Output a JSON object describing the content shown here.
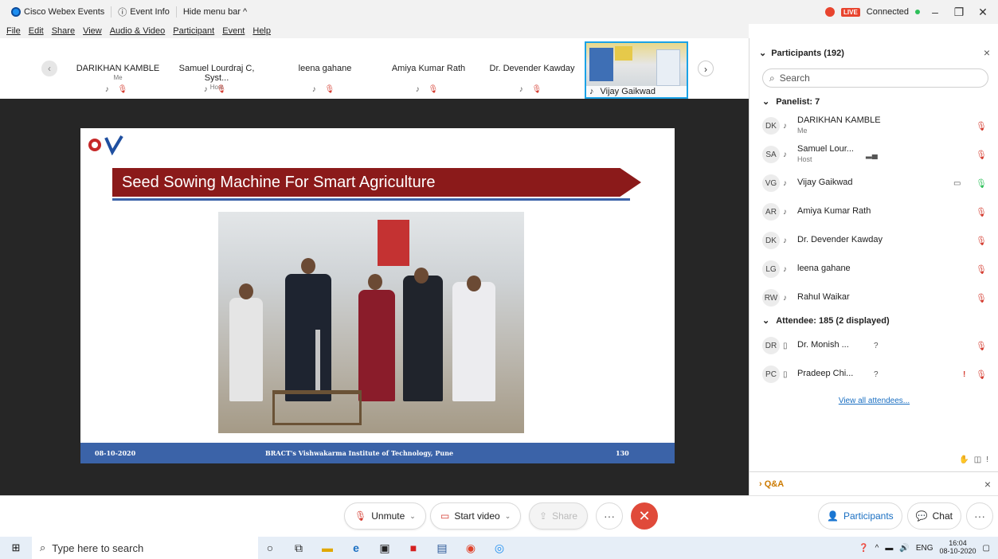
{
  "titlebar": {
    "app_name": "Cisco Webex Events",
    "event_info": "Event Info",
    "hide_menu": "Hide menu bar ^",
    "status": "Connected",
    "live_badge": "LIVE"
  },
  "menu": [
    "File",
    "Edit",
    "Share",
    "View",
    "Audio & Video",
    "Participant",
    "Event",
    "Help"
  ],
  "strip": {
    "tiles": [
      {
        "name": "DARIKHAN KAMBLE",
        "role": "Me"
      },
      {
        "name": "Samuel Lourdraj C, Syst...",
        "role": "Host"
      },
      {
        "name": "leena gahane",
        "role": ""
      },
      {
        "name": "Amiya Kumar Rath",
        "role": ""
      },
      {
        "name": "Dr. Devender Kawday",
        "role": ""
      }
    ],
    "video_tile_name": "Vijay Gaikwad"
  },
  "slide": {
    "title": "Seed Sowing Machine For Smart Agriculture",
    "footer_date": "08-10-2020",
    "footer_institute": "BRACT's Vishwakarma Institute of Technology, Pune",
    "footer_page": "130"
  },
  "controls": {
    "unmute": "Unmute",
    "start_video": "Start video",
    "share": "Share",
    "more": "···",
    "end": "✕"
  },
  "panel": {
    "title": "Participants (192)",
    "search_placeholder": "Search",
    "panelist_header": "Panelist: 7",
    "panelists": [
      {
        "initials": "DK",
        "name": "DARIKHAN KAMBLE",
        "role": "Me"
      },
      {
        "initials": "SA",
        "name": "Samuel Lour...",
        "role": "Host"
      },
      {
        "initials": "VG",
        "name": "Vijay Gaikwad",
        "role": ""
      },
      {
        "initials": "AR",
        "name": "Amiya Kumar Rath",
        "role": ""
      },
      {
        "initials": "DK",
        "name": "Dr. Devender Kawday",
        "role": ""
      },
      {
        "initials": "LG",
        "name": "leena gahane",
        "role": ""
      },
      {
        "initials": "RW",
        "name": "Rahul Waikar",
        "role": ""
      }
    ],
    "attendee_header": "Attendee: 185 (2 displayed)",
    "attendees": [
      {
        "initials": "DR",
        "name": "Dr. Monish ...",
        "mark": "?",
        "flag": ""
      },
      {
        "initials": "PC",
        "name": "Pradeep Chi...",
        "mark": "?",
        "flag": "!"
      }
    ],
    "view_all": "View all attendees...",
    "qa_label": "Q&A",
    "participants_btn": "Participants",
    "chat_btn": "Chat"
  },
  "taskbar": {
    "search_placeholder": "Type here to search",
    "lang": "ENG",
    "time": "16:04",
    "date": "08-10-2020"
  },
  "colors": {
    "accent": "#1a6fc2",
    "slide_title_bg": "#8b1a1a",
    "slide_footer_bg": "#3b63a8",
    "end_button": "#e04a3a",
    "live_red": "#e8442e"
  }
}
